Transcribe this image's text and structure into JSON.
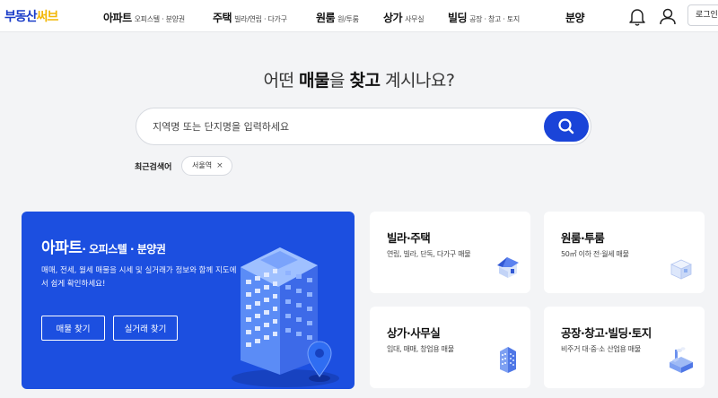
{
  "brand": {
    "part1": "부동산",
    "part2": "써브"
  },
  "nav": [
    {
      "main": "아파트",
      "sub": "오피스텔 · 분양권"
    },
    {
      "main": "주택",
      "sub": "빌라/연립 · 다가구"
    },
    {
      "main": "원룸",
      "sub": "원/투룸"
    },
    {
      "main": "상가",
      "sub": "사무실"
    },
    {
      "main": "빌딩",
      "sub": "공장 · 창고 · 토지"
    },
    {
      "main": "분양",
      "sub": ""
    }
  ],
  "header": {
    "login_label": "로그인"
  },
  "headline": {
    "p1": "어떤 ",
    "b1": "매물",
    "p2": "을 ",
    "b2": "찾고",
    "p3": " 계시나요?"
  },
  "search": {
    "placeholder": "지역명 또는 단지명을 입력하세요",
    "value": ""
  },
  "recent": {
    "label": "최근검색어",
    "chips": [
      "서울역"
    ]
  },
  "big_card": {
    "title_main": "아파트",
    "title_rest": "· 오피스텔 · 분양권",
    "desc": "매매, 전세, 월세 매물을 시세 및 실거래가 정보와 함께 지도에서 쉽게 확인하세요!",
    "btn1": "매물 찾기",
    "btn2": "실거래 찾기"
  },
  "cards": [
    {
      "title": "빌라·주택",
      "desc": "연립, 빌라, 단독, 다가구 매물",
      "icon": "house-icon"
    },
    {
      "title": "원룸·투룸",
      "desc": "50㎡ 이하 전·월세 매물",
      "icon": "room-icon"
    },
    {
      "title": "상가·사무실",
      "desc": "임대, 매매, 창업용 매물",
      "icon": "office-building-icon"
    },
    {
      "title": "공장·창고·빌딩·토지",
      "desc": "비주거 대·중·소 산업용 매물",
      "icon": "factory-icon"
    }
  ],
  "colors": {
    "brand_blue": "#1a3cc8",
    "brand_yellow": "#f2b705",
    "accent": "#1c4fe0"
  }
}
